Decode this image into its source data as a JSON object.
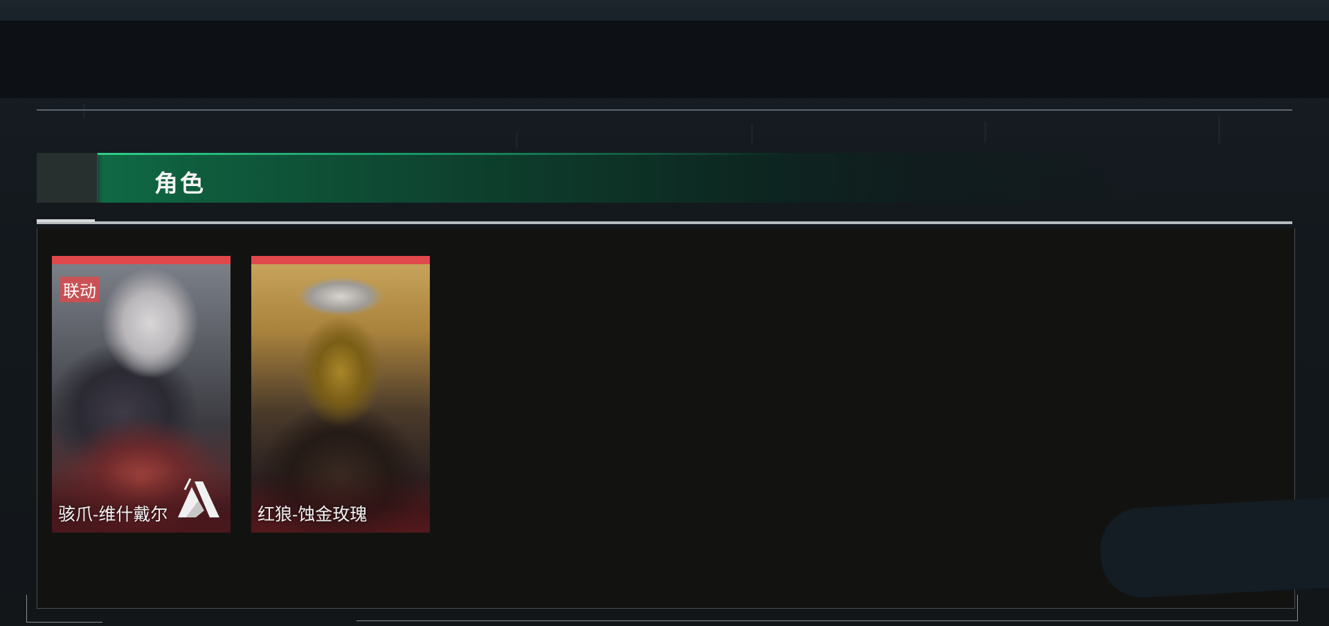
{
  "header": {
    "title": "角色"
  },
  "characters": [
    {
      "name": "骇爪-维什戴尔",
      "badge": "联动",
      "accent_color": "#e0484c",
      "logo_icon": "collab-logo-icon"
    },
    {
      "name": "红狼-蚀金玫瑰",
      "accent_color": "#e0484c"
    }
  ],
  "colors": {
    "header_green": "#0f6a44",
    "card_accent": "#e0484c",
    "panel_bg": "#121311"
  }
}
